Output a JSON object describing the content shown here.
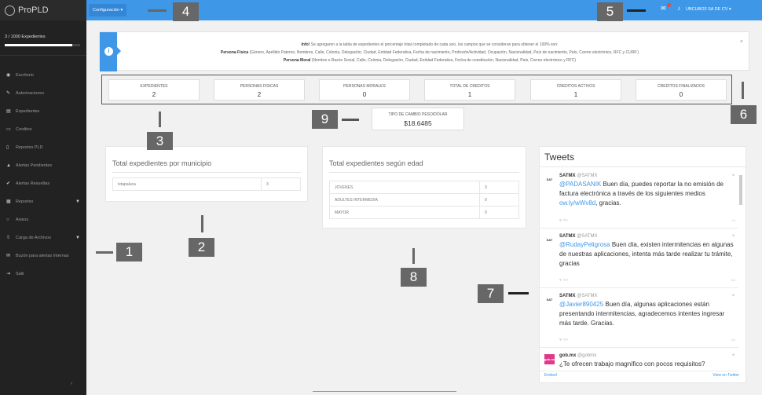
{
  "app": {
    "name": "ProPLD"
  },
  "topbar": {
    "config_label": "Configuración ▾",
    "company": "UBCUBO3 SA DE CV ▾",
    "notification_icon": "chat-icon",
    "alert_icon": "bell-icon"
  },
  "sidebar": {
    "exp_count": "3 / 1000 Expedientes",
    "progress": 0.9,
    "items": [
      {
        "label": "Escritorio",
        "icon": "dashboard-icon"
      },
      {
        "label": "Autorizaciones",
        "icon": "pencil-icon"
      },
      {
        "label": "Expedientes",
        "icon": "book-icon"
      },
      {
        "label": "Creditos",
        "icon": "card-icon"
      },
      {
        "label": "Reportes PLD",
        "icon": "file-icon"
      },
      {
        "label": "Alertas Pendientes",
        "icon": "warning-icon"
      },
      {
        "label": "Alertas Resueltas",
        "icon": "check-icon"
      },
      {
        "label": "Reportes",
        "icon": "report-icon"
      },
      {
        "label": "Avisos",
        "icon": "comment-icon"
      },
      {
        "label": "Carga de Archivos",
        "icon": "upload-icon"
      },
      {
        "label": "Buzón para alertas Internas",
        "icon": "mail-icon"
      },
      {
        "label": "Salir",
        "icon": "exit-icon"
      }
    ]
  },
  "info": {
    "lead": "Info!",
    "intro": " Se agregaron a la tabla de expedientes el porcentaje total completado de cada uno, los campos que se consideran para obtener el 100% son:",
    "fisica_label": "Persona Física",
    "fisica_text": " (Género, Apellido Paterno, Nombres, Calle, Colonia, Delegación, Ciudad, Entidad Federativa, Fecha de nacimiento, Profesión/Actividad, Ocupación, Nacionalidad, País de nacimiento, País, Correo electrónico, RFC y CURP.)",
    "moral_label": "Persona Moral",
    "moral_text": " (Nombre o Razón Social, Calle, Colonia, Delegación, Ciudad, Entidad Federativa, Fecha de constitución, Nacionalidad, País, Correo electrónico y RFC)"
  },
  "stats": [
    {
      "label": "EXPEDIENTES",
      "value": "2"
    },
    {
      "label": "PERSONAS FISICAS",
      "value": "2"
    },
    {
      "label": "PERSONAS MORALES",
      "value": "0"
    },
    {
      "label": "TOTAL DE CREDITOS",
      "value": "1"
    },
    {
      "label": "CREDITOS ACTIVOS",
      "value": "1"
    },
    {
      "label": "CREDITOS FINALIZADOS",
      "value": "0"
    }
  ],
  "exchange": {
    "label": "TIPO DE CAMBIO PESO/DÓLAR",
    "value": "$18.6485"
  },
  "municipio": {
    "title": "Total expedientes por municipio",
    "rows": [
      {
        "name": "Ixtapaluca",
        "count": "3"
      }
    ]
  },
  "edad": {
    "title": "Total expedientes según edad",
    "rows": [
      {
        "name": "JOVENES",
        "count": "3"
      },
      {
        "name": "ADULTES INTERMEDIA",
        "count": "0"
      },
      {
        "name": "MAYOR",
        "count": "0"
      }
    ]
  },
  "tweets": {
    "title": "Tweets",
    "items": [
      {
        "user": "SATMX",
        "handle": "@SATMX",
        "mention": "@PADASANIK",
        "text": " Buen día, puedes reportar la no emisión de factura electrónica a través de los siguientes medios ",
        "link": "ow.ly/wWv8d",
        "tail": ", gracias.",
        "avatar": "SAT",
        "time": "2h",
        "actions": "♥   ⟲+"
      },
      {
        "user": "SATMX",
        "handle": "@SATMX",
        "mention": "@RudayPeligrosa",
        "text": " Buen día, existen intermitencias en algunas de nuestras aplicaciones, intenta más tarde realizar tu trámite, gracias",
        "link": "",
        "tail": "",
        "avatar": "SAT",
        "time": "5m",
        "actions": "♥   ⟲+"
      },
      {
        "user": "SATMX",
        "handle": "@SATMX",
        "mention": "@Javier890425",
        "text": " Buen día, algunas aplicaciones están presentando intermitencias, agradecemos intentes ingresar más tarde. Gracias.",
        "link": "",
        "tail": "",
        "avatar": "SAT",
        "time": "2m",
        "actions": "♥   ⟲+"
      },
      {
        "user": "gob.mx",
        "handle": "@gobmx",
        "mention": "",
        "text": "¿Te ofrecen trabajo magnífico con pocos requisitos?",
        "link": "",
        "tail": "",
        "avatar": "gob.mx",
        "time": "",
        "actions": ""
      }
    ],
    "embed": "Embed",
    "view": "View on Twitter"
  },
  "callouts": [
    "1",
    "2",
    "3",
    "4",
    "5",
    "6",
    "7",
    "8",
    "9"
  ],
  "colors": {
    "accent": "#3f97e8",
    "sidebar": "#222222",
    "callout": "#676767"
  }
}
